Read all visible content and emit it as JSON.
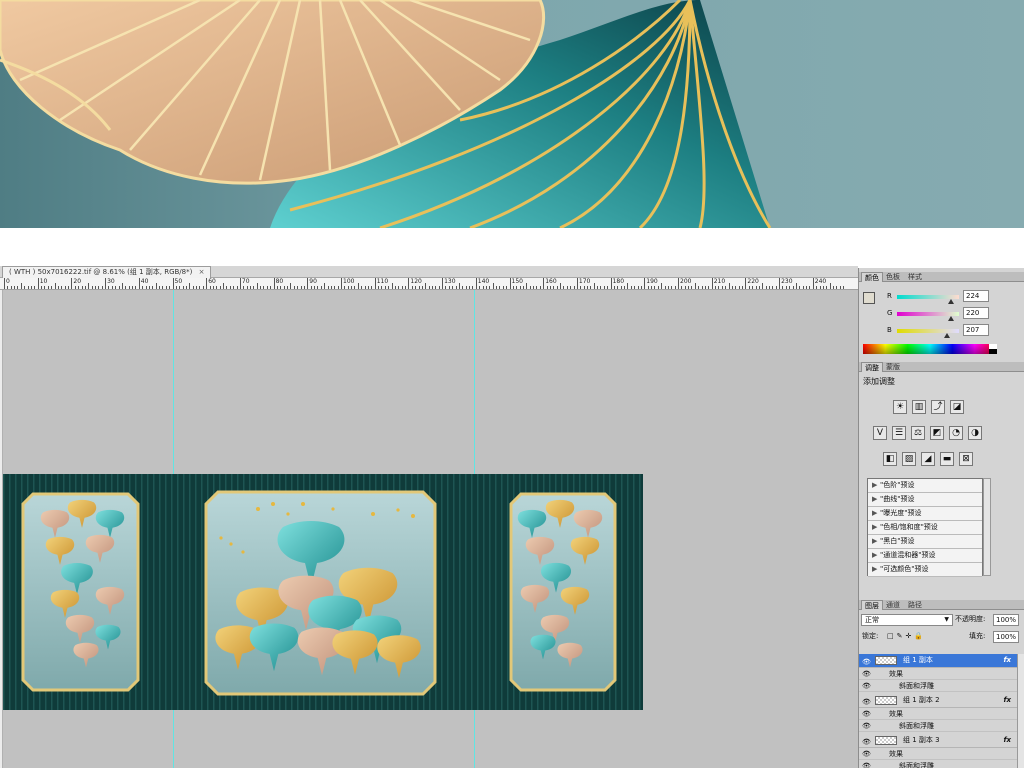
{
  "document": {
    "tab_title": "( WTH ) 50x7016222.tif @ 8.61% (组 1 副本, RGB/8*)",
    "tab_close": "×"
  },
  "ruler": {
    "labels": [
      "0",
      "10",
      "20",
      "30",
      "40",
      "50",
      "60",
      "70",
      "80",
      "90",
      "100",
      "110",
      "120",
      "130",
      "140",
      "150",
      "160",
      "170",
      "180",
      "190",
      "200",
      "210",
      "220",
      "230",
      "240"
    ]
  },
  "color_panel": {
    "tabs": [
      "颜色",
      "色板",
      "样式"
    ],
    "fg_color": "#e0dccf",
    "channels": [
      {
        "label": "R",
        "value": "224",
        "level": 0.878
      },
      {
        "label": "G",
        "value": "220",
        "level": 0.863
      },
      {
        "label": "B",
        "value": "207",
        "level": 0.812
      }
    ]
  },
  "adjust_panel": {
    "tabs": [
      "调整",
      "蒙版"
    ],
    "title": "添加调整",
    "icons_row1": [
      "brightness-contrast-icon",
      "levels-icon",
      "curves-icon",
      "exposure-icon"
    ],
    "icons_row2": [
      "vibrance-icon",
      "hue-saturation-icon",
      "color-balance-icon",
      "black-white-icon",
      "photo-filter-icon",
      "channel-mixer-icon"
    ],
    "icons_row3": [
      "invert-icon",
      "posterize-icon",
      "threshold-icon",
      "gradient-map-icon",
      "selective-color-icon"
    ],
    "presets": [
      "\"色阶\"预设",
      "\"曲线\"预设",
      "\"曝光度\"预设",
      "\"色相/饱和度\"预设",
      "\"黑白\"预设",
      "\"通道混和器\"预设",
      "\"可选颜色\"预设"
    ]
  },
  "layers_panel": {
    "tabs": [
      "图层",
      "通道",
      "路径"
    ],
    "blend_mode": "正常",
    "opacity_label": "不透明度:",
    "opacity_value": "100%",
    "lock_label": "锁定:",
    "fill_label": "填充:",
    "fill_value": "100%",
    "layers": [
      {
        "name": "组 1 副本",
        "effects": "效果",
        "bevel": "斜面和浮雕",
        "selected": true
      },
      {
        "name": "组 1 副本 2",
        "effects": "效果",
        "bevel": "斜面和浮雕",
        "selected": false
      },
      {
        "name": "组 1 副本 3",
        "effects": "效果",
        "bevel": "斜面和浮雕",
        "selected": false
      }
    ],
    "fx_label": "fx"
  },
  "colors": {
    "preview_bg": "#7ea7ad",
    "canvas_bg": "#c1c1c1",
    "mural_dark": "#0f3b3a",
    "gold": "#d6a63a",
    "teal": "#2aa8a6",
    "peach": "#d9b08a",
    "selected_layer": "#3a77d8"
  }
}
